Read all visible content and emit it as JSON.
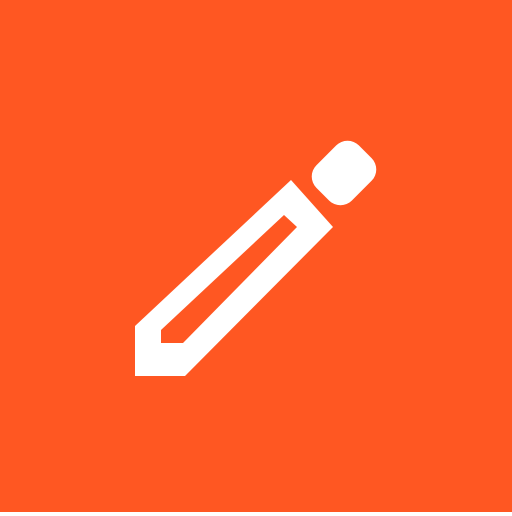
{
  "app_icon": {
    "icon": "pencil-icon",
    "background_color": "#FF5722",
    "foreground_color": "#FFFFFF"
  }
}
